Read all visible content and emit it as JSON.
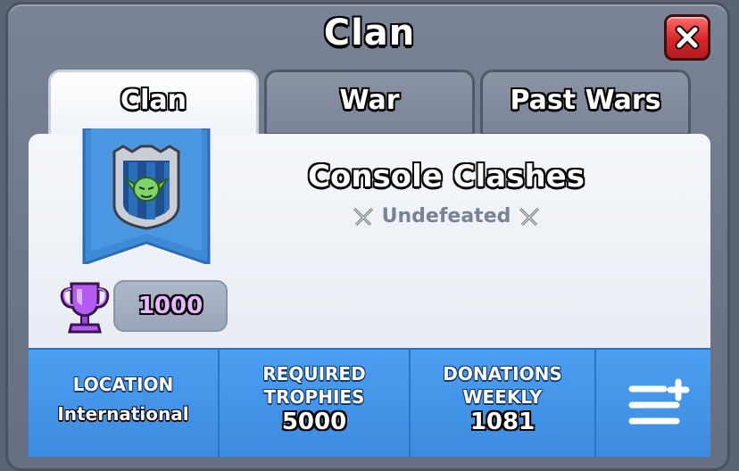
{
  "window": {
    "title": "Clan"
  },
  "tabs": [
    {
      "label": "Clan",
      "active": true
    },
    {
      "label": "War",
      "active": false
    },
    {
      "label": "Past Wars",
      "active": false
    }
  ],
  "clan": {
    "name": "Console Clashes",
    "status": "Undefeated",
    "trophies": "1000",
    "badge_icon": "goblin-shield-badge-icon"
  },
  "stats": {
    "location_label": "LOCATION",
    "location_value": "International",
    "required_label_line1": "REQUIRED",
    "required_label_line2": "TROPHIES",
    "required_value": "5000",
    "donations_label_line1": "DONATIONS",
    "donations_label_line2": "WEEKLY",
    "donations_value": "1081"
  },
  "colors": {
    "accent_blue": "#4a9ef0",
    "close_red": "#d8262a",
    "trophy_purple": "#b45cf0"
  }
}
